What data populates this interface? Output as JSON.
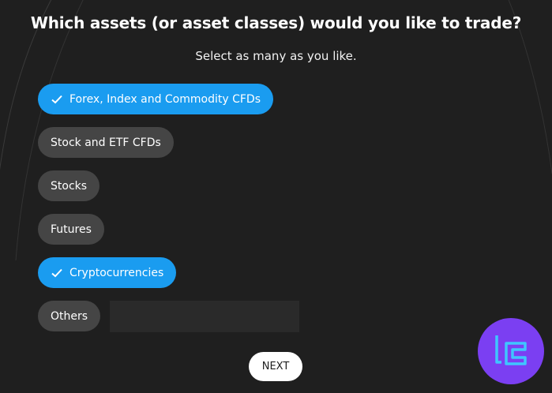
{
  "header": {
    "title": "Which assets (or asset classes) would you like to trade?",
    "subtitle": "Select as many as you like."
  },
  "options": [
    {
      "label": "Forex, Index and Commodity CFDs",
      "selected": true
    },
    {
      "label": "Stock and ETF CFDs",
      "selected": false
    },
    {
      "label": "Stocks",
      "selected": false
    },
    {
      "label": "Futures",
      "selected": false
    },
    {
      "label": "Cryptocurrencies",
      "selected": true
    },
    {
      "label": "Others",
      "selected": false
    }
  ],
  "others_input": {
    "value": "",
    "placeholder": ""
  },
  "next_label": "NEXT",
  "icons": {
    "check": "check-icon",
    "logo": "brand-logo-icon"
  },
  "colors": {
    "background": "#1f1f1f",
    "selected": "#1a9cf0",
    "unselected": "#454545",
    "logo": "#7b3ff2",
    "logo_glyph": "#3fc5ff"
  }
}
